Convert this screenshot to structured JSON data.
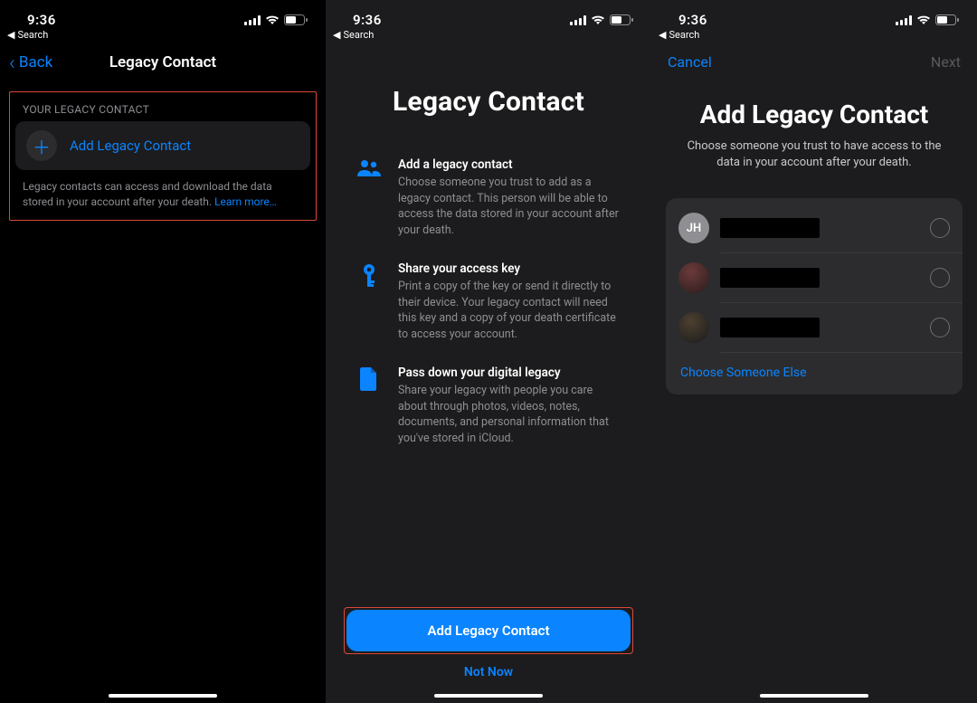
{
  "status": {
    "time": "9:36",
    "search_crumb": "Search"
  },
  "phone1": {
    "nav_back": "Back",
    "nav_title": "Legacy Contact",
    "section_header": "YOUR LEGACY CONTACT",
    "add_label": "Add Legacy Contact",
    "footer_text": "Legacy contacts can access and download the data stored in your account after your death. ",
    "footer_link": "Learn more…"
  },
  "phone2": {
    "title": "Legacy Contact",
    "items": [
      {
        "title": "Add a legacy contact",
        "desc": "Choose someone you trust to add as a legacy contact. This person will be able to access the data stored in your account after your death."
      },
      {
        "title": "Share your access key",
        "desc": "Print a copy of the key or send it directly to their device. Your legacy contact will need this key and a copy of your death certificate to access your account."
      },
      {
        "title": "Pass down your digital legacy",
        "desc": "Share your legacy with people you care about through photos, videos, notes, documents, and personal information that you've stored in iCloud."
      }
    ],
    "primary_button": "Add Legacy Contact",
    "secondary_button": "Not Now"
  },
  "phone3": {
    "cancel": "Cancel",
    "next": "Next",
    "title": "Add Legacy Contact",
    "subtitle": "Choose someone you trust to have access to the data in your account after your death.",
    "contacts": [
      {
        "initials": "JH"
      },
      {
        "initials": ""
      },
      {
        "initials": ""
      }
    ],
    "choose_else": "Choose Someone Else"
  }
}
